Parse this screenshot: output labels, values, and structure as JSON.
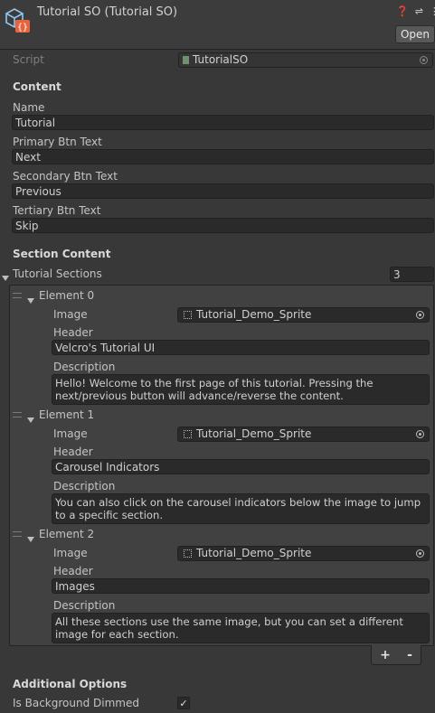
{
  "header": {
    "title": "Tutorial SO (Tutorial SO)",
    "open_label": "Open"
  },
  "script_row": {
    "label": "Script",
    "value": "TutorialSO"
  },
  "content": {
    "heading": "Content",
    "name_label": "Name",
    "name_value": "Tutorial",
    "primary_label": "Primary Btn Text",
    "primary_value": "Next",
    "secondary_label": "Secondary Btn Text",
    "secondary_value": "Previous",
    "tertiary_label": "Tertiary Btn Text",
    "tertiary_value": "Skip"
  },
  "section_content": {
    "heading": "Section Content",
    "list_label": "Tutorial Sections",
    "count": "3",
    "elements": [
      {
        "label": "Element 0",
        "image_label": "Image",
        "image_value": "Tutorial_Demo_Sprite",
        "header_label": "Header",
        "header_value": "Velcro's Tutorial UI",
        "description_label": "Description",
        "description_value": "Hello! Welcome to the first page of this tutorial. Pressing the next/previous button will advance/reverse the content."
      },
      {
        "label": "Element 1",
        "image_label": "Image",
        "image_value": "Tutorial_Demo_Sprite",
        "header_label": "Header",
        "header_value": "Carousel Indicators",
        "description_label": "Description",
        "description_value": "You can also click on the carousel indicators below the image to jump to a specific section."
      },
      {
        "label": "Element 2",
        "image_label": "Image",
        "image_value": "Tutorial_Demo_Sprite",
        "header_label": "Header",
        "header_value": "Images",
        "description_label": "Description",
        "description_value": "All these sections use the same image, but you can set a different image for each section."
      }
    ],
    "add_label": "+",
    "remove_label": "-"
  },
  "additional": {
    "heading": "Additional Options",
    "dimmed_label": "Is Background Dimmed",
    "dimmed_checked": true,
    "check_glyph": "✓"
  },
  "icons": {
    "asset_icon": "scriptable-object-icon",
    "help": "help-icon",
    "settings": "preset-icon",
    "menu": "kebab-menu-icon"
  }
}
